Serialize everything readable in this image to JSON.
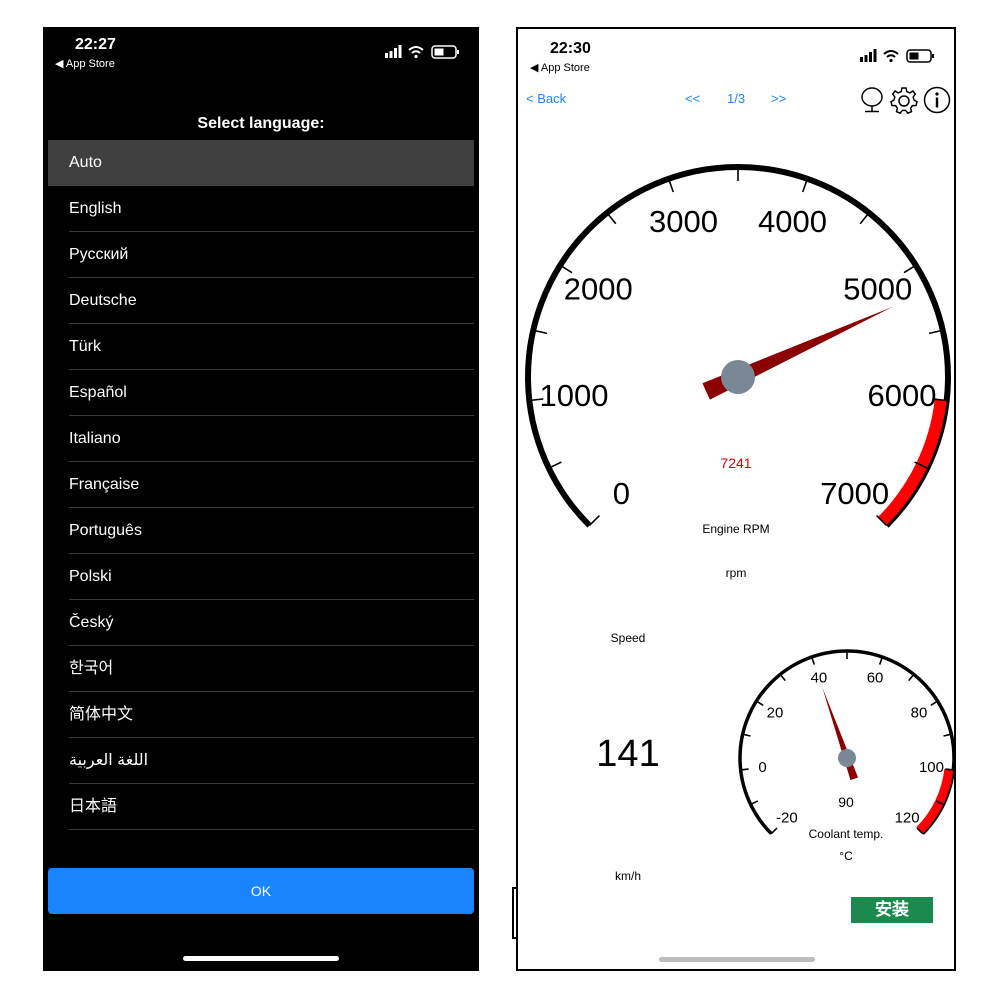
{
  "left_screen": {
    "status": {
      "time": "22:27",
      "back_app": "◀ App Store"
    },
    "title": "Select language:",
    "languages": [
      {
        "label": "Auto",
        "selected": true
      },
      {
        "label": "English"
      },
      {
        "label": "Русский"
      },
      {
        "label": "Deutsche"
      },
      {
        "label": "Türk"
      },
      {
        "label": "Español"
      },
      {
        "label": "Italiano"
      },
      {
        "label": "Française"
      },
      {
        "label": "Português"
      },
      {
        "label": "Polski"
      },
      {
        "label": "Český"
      },
      {
        "label": "한국어"
      },
      {
        "label": "简体中文"
      },
      {
        "label": "اللغة العربية"
      },
      {
        "label": "日本語"
      }
    ],
    "ok_label": "OK"
  },
  "right_screen": {
    "status": {
      "time": "22:30",
      "back_app": "◀ App Store"
    },
    "nav": {
      "back": "< Back",
      "prev": "<<",
      "page": "1/3",
      "next": ">>"
    },
    "toolbar_icons": [
      "microphone-icon",
      "gear-icon",
      "info-icon"
    ],
    "rpm_gauge": {
      "ticks": [
        "0",
        "1000",
        "2000",
        "3000",
        "4000",
        "5000",
        "6000",
        "7000"
      ],
      "min": 0,
      "max": 7000,
      "value_text": "7241",
      "needle_value": 5200,
      "redline_from": 6000,
      "label": "Engine RPM",
      "unit": "rpm"
    },
    "speed": {
      "label": "Speed",
      "value": "141",
      "unit": "km/h"
    },
    "coolant_gauge": {
      "ticks": [
        "-20",
        "0",
        "20",
        "40",
        "60",
        "80",
        "100",
        "120"
      ],
      "min": -20,
      "max": 120,
      "center_value": "90",
      "needle_value": 40,
      "redline_from": 100,
      "label": "Coolant temp.",
      "unit": "°C"
    },
    "install_label": "安装"
  },
  "colors": {
    "accent_blue": "#1a84ff",
    "selected_row": "#404040",
    "redline": "#ff0000",
    "needle": "#8b0000",
    "hub": "#7a8794",
    "install_green": "#1a8a4e"
  }
}
